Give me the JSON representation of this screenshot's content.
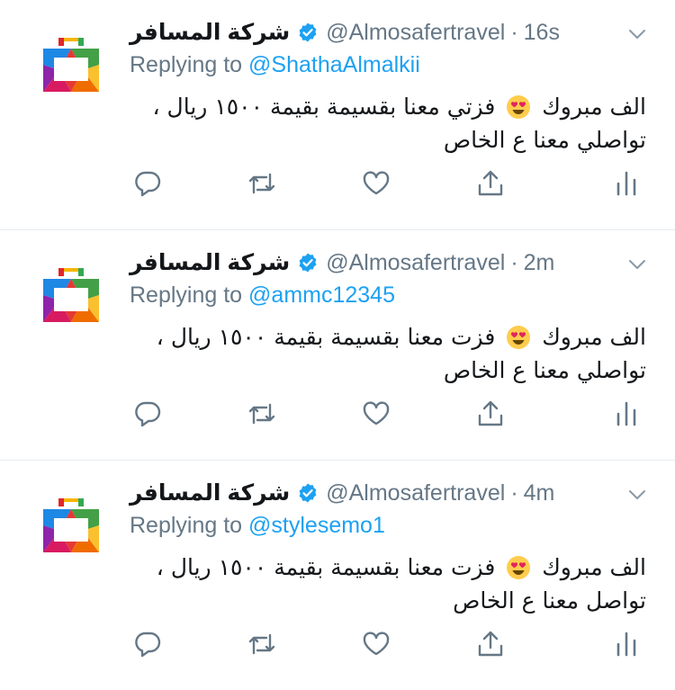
{
  "colors": {
    "link": "#1da1f2",
    "muted": "#657786",
    "text": "#14171a",
    "divider": "#e6ecf0"
  },
  "tweets": [
    {
      "display_name": "شركة المسافر",
      "handle": "@Almosafertravel",
      "separator": "·",
      "time": "16s",
      "replying_prefix": "Replying to ",
      "replying_to": "@ShathaAlmalkii",
      "line1_before_emoji": "الف مبروك",
      "line1_after_emoji": "فزتي معنا بقسيمة بقيمة ١٥٠٠ ريال ،",
      "line2": "تواصلي معنا ع الخاص"
    },
    {
      "display_name": "شركة المسافر",
      "handle": "@Almosafertravel",
      "separator": "·",
      "time": "2m",
      "replying_prefix": "Replying to ",
      "replying_to": "@ammc12345",
      "line1_before_emoji": "الف مبروك",
      "line1_after_emoji": "فزت معنا بقسيمة بقيمة ١٥٠٠ ريال ،",
      "line2": "تواصلي معنا ع الخاص"
    },
    {
      "display_name": "شركة المسافر",
      "handle": "@Almosafertravel",
      "separator": "·",
      "time": "4m",
      "replying_prefix": "Replying to ",
      "replying_to": "@stylesemo1",
      "line1_before_emoji": "الف مبروك",
      "line1_after_emoji": "فزت معنا بقسيمة بقيمة ١٥٠٠ ريال ،",
      "line2": "تواصل معنا ع الخاص"
    }
  ],
  "icons": [
    "reply-icon",
    "retweet-icon",
    "like-icon",
    "share-icon",
    "analytics-icon",
    "verified-badge-icon",
    "chevron-down-icon",
    "heart-eyes-emoji-icon"
  ]
}
